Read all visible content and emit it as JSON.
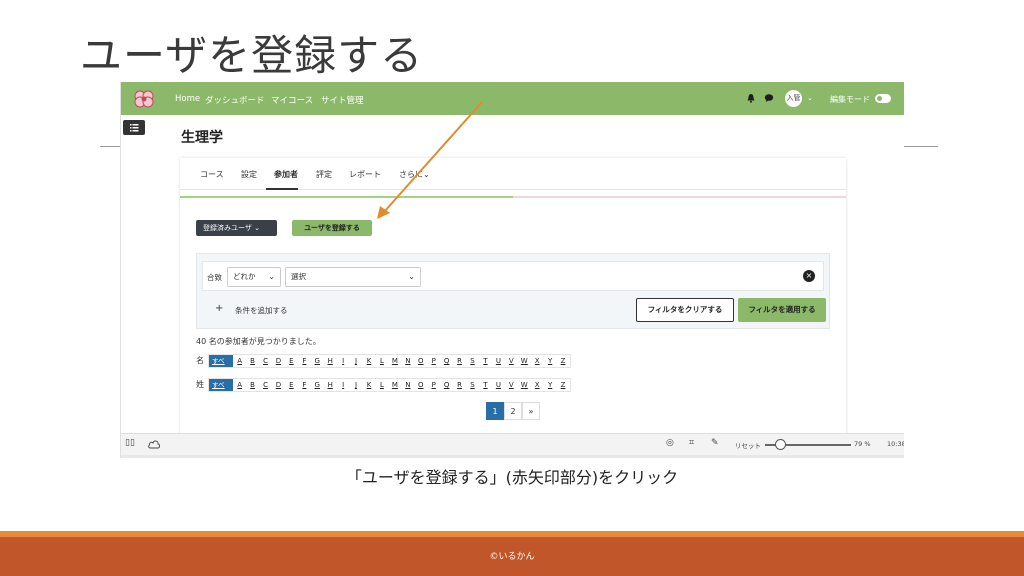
{
  "slide": {
    "title": "ユーザを登録する",
    "caption": "「ユーザを登録する」(赤矢印部分)をクリック",
    "copyright": "©いるかん"
  },
  "navbar": {
    "links": [
      "Home",
      "ダッシュボード",
      "マイコース",
      "サイト管理"
    ],
    "avatar_text": "入管",
    "edit_mode_label": "編集モード",
    "icons": [
      "bell-icon",
      "chat-icon"
    ]
  },
  "course": {
    "title": "生理学"
  },
  "tabs": [
    "コース",
    "設定",
    "参加者",
    "評定",
    "レポート",
    "さらに"
  ],
  "active_tab": "参加者",
  "buttons": {
    "enrolled_users": "登録済みユーザ",
    "register_user": "ユーザを登録する",
    "add_condition": "条件を追加する",
    "clear_filters": "フィルタをクリアする",
    "apply_filters": "フィルタを適用する"
  },
  "filter": {
    "match_label": "合致",
    "match_value": "どれか",
    "select_value": "選択"
  },
  "participants": {
    "found_text": "40 名の参加者が見つかりました。",
    "first_name_label": "名",
    "last_name_label": "姓",
    "all_label": "すべて",
    "letters": [
      "A",
      "B",
      "C",
      "D",
      "E",
      "F",
      "G",
      "H",
      "I",
      "J",
      "K",
      "L",
      "M",
      "N",
      "O",
      "P",
      "Q",
      "R",
      "S",
      "T",
      "U",
      "V",
      "W",
      "X",
      "Y",
      "Z"
    ]
  },
  "pagination": {
    "pages": [
      "1",
      "2",
      "»"
    ],
    "current": "1"
  },
  "taskbar": {
    "reset_label": "リセット",
    "zoom": "79 %",
    "time": "10:38"
  },
  "colors": {
    "nav_green": "#8cb86a",
    "arrow_orange": "#e38a2e",
    "footer_orange": "#c0562a",
    "active_blue": "#2a6ea6"
  }
}
